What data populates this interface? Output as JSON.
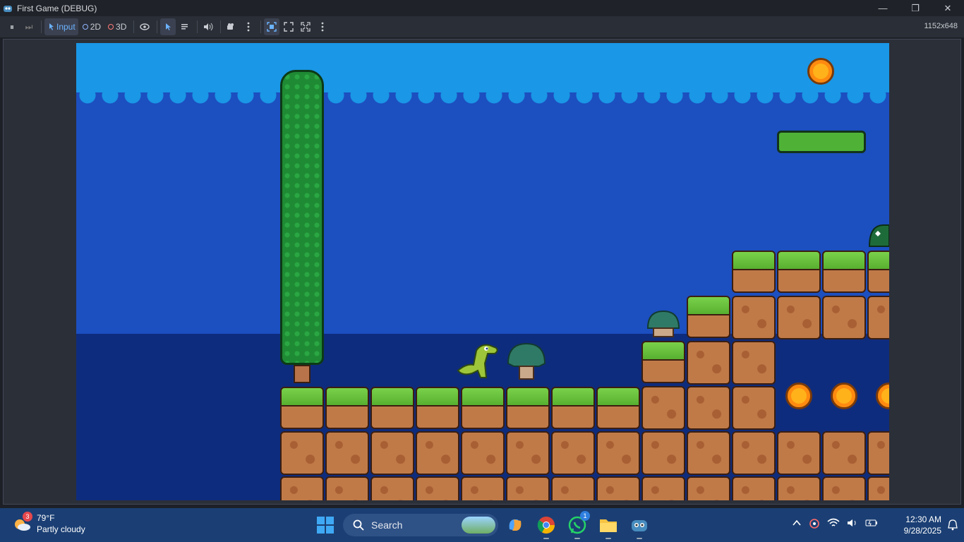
{
  "window": {
    "title": "First Game (DEBUG)",
    "icon": "godot-icon"
  },
  "window_controls": {
    "minimize": "—",
    "restore": "❐",
    "close": "✕"
  },
  "toolbar": {
    "pause": "⏸",
    "step": "⏭",
    "input_label": "Input",
    "mode_2d": "2D",
    "mode_3d": "3D",
    "resolution": "1152x648"
  },
  "taskbar": {
    "weather_temp": "79°F",
    "weather_desc": "Partly cloudy",
    "weather_badge": "3",
    "search_label": "Search",
    "whatsapp_badge": "1",
    "time": "12:30 AM",
    "date": "9/28/2025"
  }
}
